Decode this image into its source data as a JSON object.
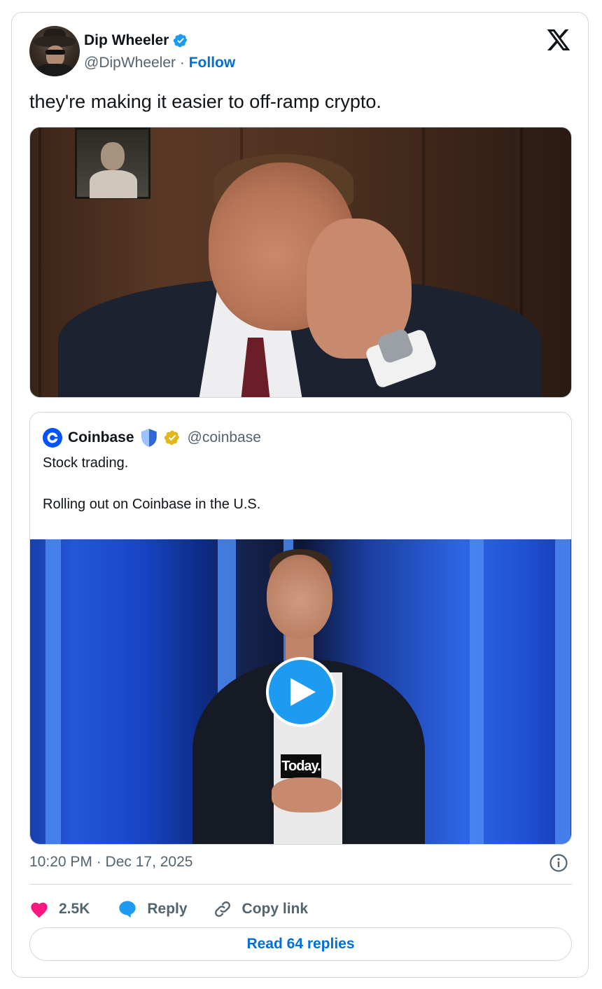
{
  "author": {
    "display_name": "Dip Wheeler",
    "handle": "@DipWheeler",
    "separator": "·",
    "follow_label": "Follow",
    "verified_color": "#1d9bf0"
  },
  "tweet": {
    "text": "they're making it easier to off-ramp crypto.",
    "timestamp": "10:20 PM · Dec 17, 2025"
  },
  "quoted": {
    "display_name": "Coinbase",
    "handle": "@coinbase",
    "text_line1": "Stock trading.",
    "text_line2": "Rolling out on Coinbase in the U.S.",
    "video_caption": "Today.",
    "brand_color": "#0052ff",
    "gold_badge_color": "#e2b719"
  },
  "actions": {
    "likes_count": "2.5K",
    "reply_label": "Reply",
    "copy_link_label": "Copy link",
    "like_color": "#f91880",
    "reply_color": "#1d9bf0"
  },
  "footer": {
    "read_replies_label": "Read 64 replies"
  },
  "icons": [
    "x-logo-icon",
    "verified-badge-icon",
    "coinbase-logo-icon",
    "shield-icon",
    "gold-verified-icon",
    "play-icon",
    "info-icon",
    "heart-icon",
    "speech-bubble-icon",
    "link-icon"
  ]
}
